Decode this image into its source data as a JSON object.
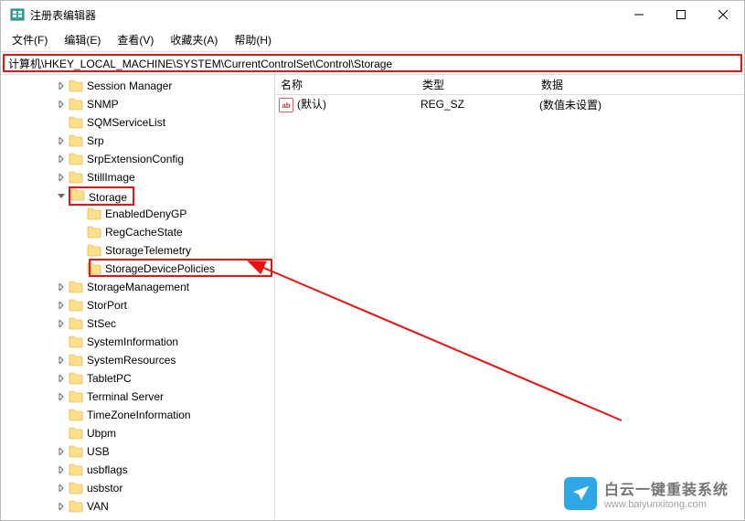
{
  "title": "注册表编辑器",
  "menubar": [
    "文件(F)",
    "编辑(E)",
    "查看(V)",
    "收藏夹(A)",
    "帮助(H)"
  ],
  "addressbar": "计算机\\HKEY_LOCAL_MACHINE\\SYSTEM\\CurrentControlSet\\Control\\Storage",
  "tree": [
    {
      "label": "Session Manager",
      "depth": 0,
      "exp": ">"
    },
    {
      "label": "SNMP",
      "depth": 0,
      "exp": ">"
    },
    {
      "label": "SQMServiceList",
      "depth": 0,
      "exp": ""
    },
    {
      "label": "Srp",
      "depth": 0,
      "exp": ">"
    },
    {
      "label": "SrpExtensionConfig",
      "depth": 0,
      "exp": ">"
    },
    {
      "label": "StillImage",
      "depth": 0,
      "exp": ">"
    },
    {
      "label": "Storage",
      "depth": 0,
      "exp": "v",
      "hl": "storage"
    },
    {
      "label": "EnabledDenyGP",
      "depth": 1,
      "exp": ""
    },
    {
      "label": "RegCacheState",
      "depth": 1,
      "exp": ""
    },
    {
      "label": "StorageTelemetry",
      "depth": 1,
      "exp": ""
    },
    {
      "label": "StorageDevicePolicies",
      "depth": 1,
      "exp": "",
      "hl": "sdp"
    },
    {
      "label": "StorageManagement",
      "depth": 0,
      "exp": ">"
    },
    {
      "label": "StorPort",
      "depth": 0,
      "exp": ">"
    },
    {
      "label": "StSec",
      "depth": 0,
      "exp": ">"
    },
    {
      "label": "SystemInformation",
      "depth": 0,
      "exp": ""
    },
    {
      "label": "SystemResources",
      "depth": 0,
      "exp": ">"
    },
    {
      "label": "TabletPC",
      "depth": 0,
      "exp": ">"
    },
    {
      "label": "Terminal Server",
      "depth": 0,
      "exp": ">"
    },
    {
      "label": "TimeZoneInformation",
      "depth": 0,
      "exp": ""
    },
    {
      "label": "Ubpm",
      "depth": 0,
      "exp": ""
    },
    {
      "label": "USB",
      "depth": 0,
      "exp": ">"
    },
    {
      "label": "usbflags",
      "depth": 0,
      "exp": ">"
    },
    {
      "label": "usbstor",
      "depth": 0,
      "exp": ">"
    },
    {
      "label": "VAN",
      "depth": 0,
      "exp": ">"
    }
  ],
  "value_columns": {
    "name": "名称",
    "type": "类型",
    "data": "数据"
  },
  "value_rows": [
    {
      "name": "(默认)",
      "type": "REG_SZ",
      "data": "(数值未设置)"
    }
  ],
  "watermark": {
    "line1": "白云一键重装系统",
    "line2": "www.baiyunxitong.com"
  }
}
